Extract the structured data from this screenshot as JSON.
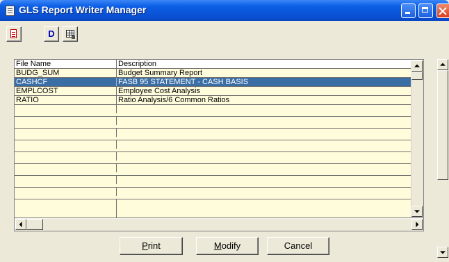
{
  "window": {
    "title": "GLS Report Writer Manager",
    "controls": [
      "minimize",
      "maximize",
      "close"
    ]
  },
  "toolbar": {
    "buttons": [
      {
        "icon": "new-document-icon"
      },
      {
        "icon": "description-icon",
        "label": "D"
      },
      {
        "icon": "grid-edit-icon"
      }
    ]
  },
  "grid": {
    "columns": [
      "File Name",
      "Description"
    ],
    "rows": [
      {
        "file": "BUDG_SUM",
        "description": "Budget Summary Report"
      },
      {
        "file": "CASHCF",
        "description": "FASB 95 STATEMENT - CASH BASIS",
        "selected": true
      },
      {
        "file": "EMPLCOST",
        "description": "Employee Cost Analysis"
      },
      {
        "file": "RATIO",
        "description": "Ratio Analysis/6 Common Ratios"
      }
    ],
    "empty_rows": 8
  },
  "buttons": {
    "print": {
      "underline": "P",
      "rest": "rint"
    },
    "modify": {
      "underline": "M",
      "rest": "odify"
    },
    "cancel": {
      "label": "Cancel"
    }
  },
  "colors": {
    "row_background": "#fffcdc",
    "selected_row": "#3a6ea5",
    "titlebar": "#0a52d6",
    "window_face": "#ece9d8"
  }
}
